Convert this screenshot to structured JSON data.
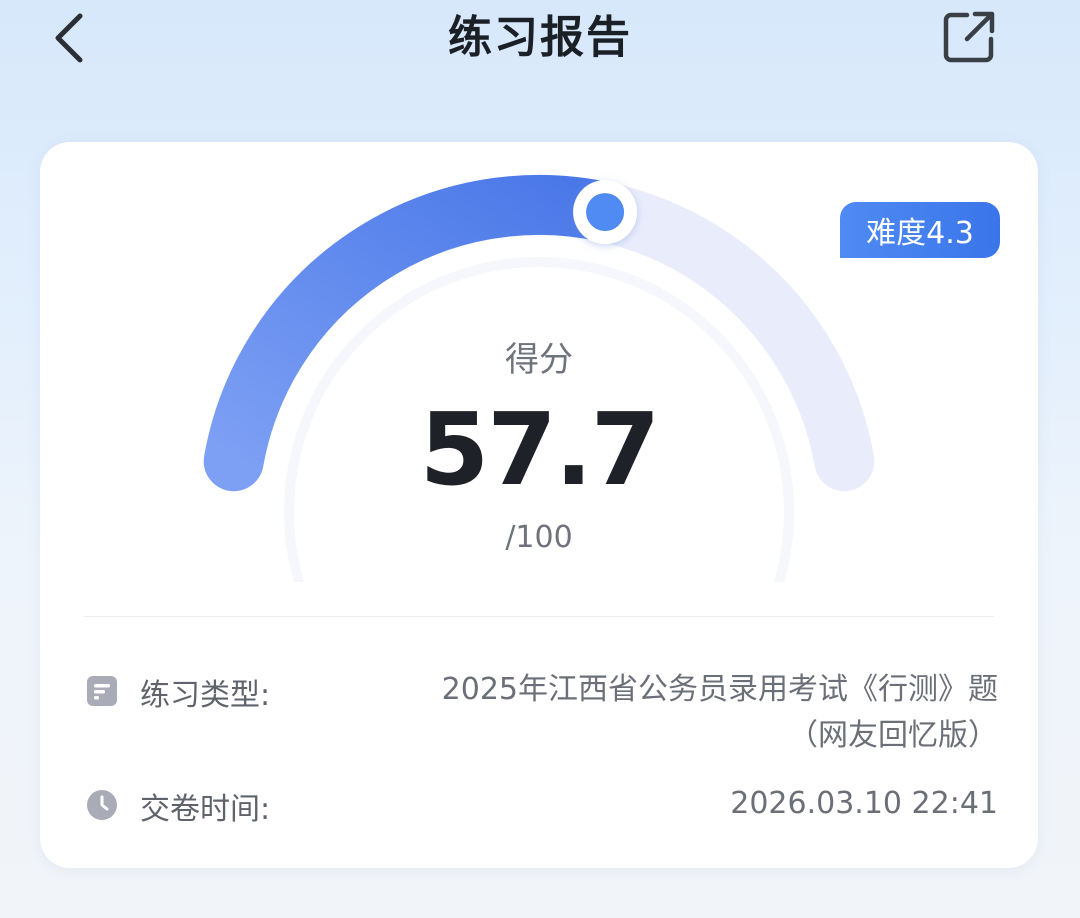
{
  "header": {
    "title": "练习报告",
    "back_icon": "chevron-left-icon",
    "share_icon": "share-external-icon"
  },
  "report": {
    "difficulty_badge": "难度4.3",
    "score_label": "得分",
    "score": 57.7,
    "score_display": "57.7",
    "score_max": "/100",
    "score_max_value": 100
  },
  "info": {
    "type_label": "练习类型:",
    "type_value_line1": "2025年江西省公务员录用考试《行测》题",
    "type_value_line2": "（网友回忆版）",
    "time_label": "交卷时间:",
    "time_value": "2026.03.10 22:41",
    "type_icon": "document-icon",
    "time_icon": "clock-icon"
  },
  "colors": {
    "accent": "#4f8bf2",
    "track": "#e9ecfb",
    "gauge_start": "#7da0f4",
    "gauge_end": "#4a78e8",
    "badge": "#3a75ea"
  }
}
